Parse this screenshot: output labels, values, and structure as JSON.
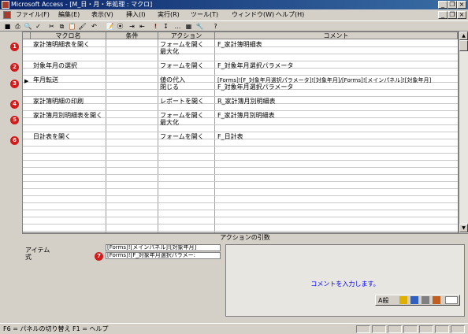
{
  "window": {
    "title": "Microsoft Access - [M_日・月・年処理 : マクロ]",
    "minimize": "_",
    "restore": "❐",
    "close": "×"
  },
  "menu": [
    "ファイル(F)",
    "編集(E)",
    "表示(V)",
    "挿入(I)",
    "実行(R)",
    "ツール(T)",
    "ウィンドウ(W)",
    "ヘルプ(H)"
  ],
  "toolbar": {
    "icons": [
      "save-icon",
      "print-icon",
      "preview-icon",
      "spelling-icon",
      "cut-icon",
      "copy-icon",
      "paste-icon",
      "format-painter-icon",
      "undo-icon",
      "macro-names-icon",
      "conditions-icon",
      "insert-row-icon",
      "delete-row-icon",
      "run-icon",
      "step-icon",
      "build-icon",
      "database-window-icon",
      "new-object-icon",
      "help-icon"
    ],
    "glyphs": [
      "■",
      "⎙",
      "🔍",
      "✓",
      "✂",
      "⧉",
      "📋",
      "🖌",
      "↶",
      "📝",
      "⦿",
      "⇥",
      "⇤",
      "!",
      "↧",
      "…",
      "▦",
      "🔧",
      "?"
    ]
  },
  "grid": {
    "columns": [
      "マクロ名",
      "条件",
      "アクション",
      "コメント"
    ],
    "rows": [
      {
        "num": "1",
        "name": "家計簿明細表を開く",
        "action": [
          "フォームを開く",
          "最大化"
        ],
        "comment": [
          "F_家計簿明細表"
        ]
      },
      {
        "num": "2",
        "name": "対象年月の選択",
        "action": [
          "フォームを開く"
        ],
        "comment": [
          "F_対象年月選択パラメータ"
        ]
      },
      {
        "num": "3",
        "name": "年月転送",
        "action": [
          "値の代入",
          "閉じる"
        ],
        "comment": [
          "[Forms]![F_対象年月選択パラメータ]![対象年月]/[Forms]![メインパネル]![対象年月]",
          "F_対象年月選択パラメータ"
        ],
        "current": true
      },
      {
        "num": "4",
        "name": "家計簿明細の印刷",
        "action": [
          "レポートを開く"
        ],
        "comment": [
          "R_家計簿月別明細表"
        ]
      },
      {
        "num": "5",
        "name": "家計簿月別明細表を開く",
        "action": [
          "フォームを開く",
          "最大化"
        ],
        "comment": [
          "F_家計簿月別明細表"
        ]
      },
      {
        "num": "6",
        "name": "日計表を開く",
        "action": [
          "フォームを開く"
        ],
        "comment": [
          "F_日計表"
        ]
      }
    ]
  },
  "args": {
    "header": "アクションの引数",
    "item_label": "アイテム",
    "item_value": "[Forms]![メインパネル]![対象年月]",
    "expr_label": "式",
    "expr_value": "[Forms]![F_対象年月選択パラメー:",
    "expr_num": "7",
    "comment_hint": "コメントを入力します。"
  },
  "status": {
    "text": "F6 = パネルの切り替え   F1 = ヘルプ"
  },
  "colors": {
    "accent": "#0a246a",
    "annotation": "#d21c1c",
    "hint": "#0000ff"
  }
}
